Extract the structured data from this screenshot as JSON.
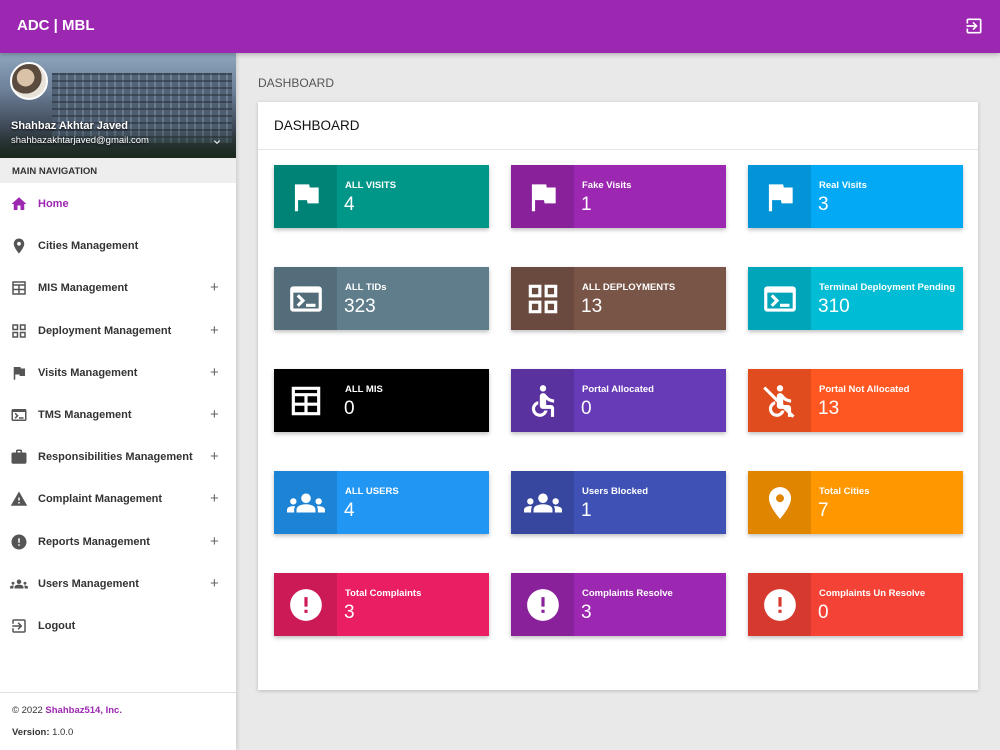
{
  "header": {
    "brand": "ADC | MBL"
  },
  "user": {
    "name": "Shahbaz Akhtar Javed",
    "email": "shahbazakhtarjaved@gmail.com"
  },
  "sidebar": {
    "nav_header": "MAIN NAVIGATION",
    "items": [
      {
        "label": "Home",
        "icon": "home-icon",
        "active": true,
        "expandable": false
      },
      {
        "label": "Cities Management",
        "icon": "location-pin-icon",
        "expandable": false
      },
      {
        "label": "MIS Management",
        "icon": "table-icon",
        "expandable": true
      },
      {
        "label": "Deployment Management",
        "icon": "grid-icon",
        "expandable": true
      },
      {
        "label": "Visits Management",
        "icon": "flag-icon",
        "expandable": true
      },
      {
        "label": "TMS Management",
        "icon": "terminal-icon",
        "expandable": true
      },
      {
        "label": "Responsibilities Management",
        "icon": "briefcase-icon",
        "expandable": true
      },
      {
        "label": "Complaint Management",
        "icon": "warning-icon",
        "expandable": true
      },
      {
        "label": "Reports Management",
        "icon": "alert-circle-icon",
        "expandable": true
      },
      {
        "label": "Users Management",
        "icon": "group-icon",
        "expandable": true
      },
      {
        "label": "Logout",
        "icon": "logout-icon",
        "expandable": false
      }
    ],
    "plus": "+"
  },
  "footer": {
    "copyright": "© 2022 ",
    "company": "Shahbaz514, Inc.",
    "version_label": "Version:",
    "version": " 1.0.0"
  },
  "breadcrumb": "DASHBOARD",
  "card_title": "DASHBOARD",
  "colors": {
    "primary": "#9c27b0"
  },
  "boxes": [
    {
      "label": "ALL VISITS",
      "value": "4",
      "icon": "flag-icon",
      "color": "#009688"
    },
    {
      "label": "Fake Visits",
      "value": "1",
      "icon": "flag-icon",
      "color": "#9c27b0"
    },
    {
      "label": "Real Visits",
      "value": "3",
      "icon": "flag-icon",
      "color": "#03a9f4"
    },
    {
      "label": "ALL TIDs",
      "value": "323",
      "icon": "terminal-icon",
      "color": "#607d8b"
    },
    {
      "label": "ALL DEPLOYMENTS",
      "value": "13",
      "icon": "grid-icon",
      "color": "#795548"
    },
    {
      "label": "Terminal Deployment Pending",
      "value": "310",
      "icon": "terminal-icon",
      "color": "#00bcd4"
    },
    {
      "label": "ALL MIS",
      "value": "0",
      "icon": "table-icon",
      "color": "#000000"
    },
    {
      "label": "Portal Allocated",
      "value": "0",
      "icon": "accessible-icon",
      "color": "#673ab7"
    },
    {
      "label": "Portal Not Allocated",
      "value": "13",
      "icon": "not-accessible-icon",
      "color": "#ff5722"
    },
    {
      "label": "ALL USERS",
      "value": "4",
      "icon": "group-icon",
      "color": "#2196f3"
    },
    {
      "label": "Users Blocked",
      "value": "1",
      "icon": "group-icon",
      "color": "#3f51b5"
    },
    {
      "label": "Total Cities",
      "value": "7",
      "icon": "location-pin-icon",
      "color": "#ff9800"
    },
    {
      "label": "Total Complaints",
      "value": "3",
      "icon": "alert-circle-icon",
      "color": "#e91e63"
    },
    {
      "label": "Complaints Resolve",
      "value": "3",
      "icon": "alert-circle-icon",
      "color": "#9c27b0"
    },
    {
      "label": "Complaints Un Resolve",
      "value": "0",
      "icon": "alert-circle-icon",
      "color": "#f44336"
    }
  ]
}
